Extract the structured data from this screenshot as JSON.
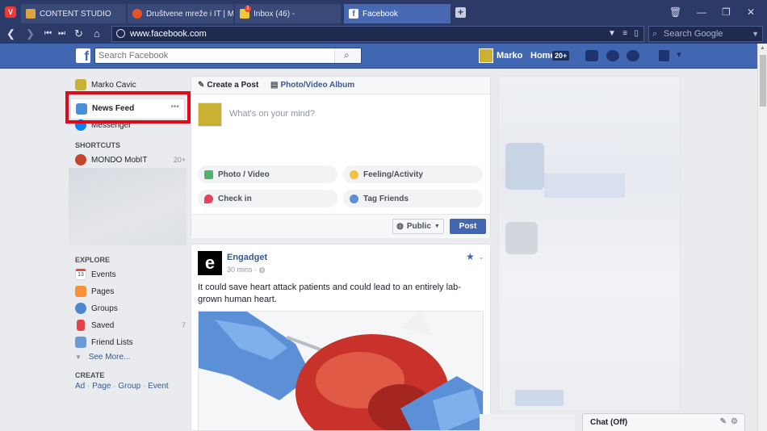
{
  "browser": {
    "tabs": [
      {
        "label": "CONTENT STUDIO",
        "active": false
      },
      {
        "label": "Društvene mreže i IT | Mond",
        "active": false
      },
      {
        "label": "Inbox (46) -",
        "active": false,
        "badge": "1"
      },
      {
        "label": "Facebook",
        "active": true
      }
    ],
    "url": "www.facebook.com",
    "search_placeholder": "Search Google"
  },
  "fb_header": {
    "search_placeholder": "Search Facebook",
    "user_name": "Marko",
    "home_label": "Home",
    "home_badge": "20+",
    "logo": "f"
  },
  "left_nav": {
    "profile_name": "Marko Cavic",
    "news_feed": "News Feed",
    "more_dots": "•••",
    "messenger": "Messenger",
    "shortcuts_header": "SHORTCUTS",
    "shortcut_item": "MONDO MobIT",
    "shortcut_count": "20+",
    "explore_header": "EXPLORE",
    "explore_items": [
      {
        "label": "Events",
        "count": ""
      },
      {
        "label": "Pages",
        "count": ""
      },
      {
        "label": "Groups",
        "count": ""
      },
      {
        "label": "Saved",
        "count": "7"
      },
      {
        "label": "Friend Lists",
        "count": ""
      }
    ],
    "events_day": "13",
    "see_more": "See More...",
    "create_header": "CREATE",
    "create_links": [
      "Ad",
      "Page",
      "Group",
      "Event"
    ],
    "create_sep": "·"
  },
  "composer": {
    "tab_create_post": "Create a Post",
    "tab_photo_album": "Photo/Video Album",
    "placeholder": "What's on your mind?",
    "actions": [
      "Photo / Video",
      "Feeling/Activity",
      "Check in",
      "Tag Friends"
    ],
    "privacy": "Public",
    "post_button": "Post"
  },
  "post": {
    "author": "Engadget",
    "logo_letter": "e",
    "time": "30 mins ·",
    "text": "It could save heart attack patients and could lead to an entirely lab-grown human heart."
  },
  "chat": {
    "label": "Chat (Off)"
  },
  "colors": {
    "fb_blue": "#4267b2",
    "browser_chrome": "#2b3a67",
    "highlight_red": "#e2081a"
  }
}
